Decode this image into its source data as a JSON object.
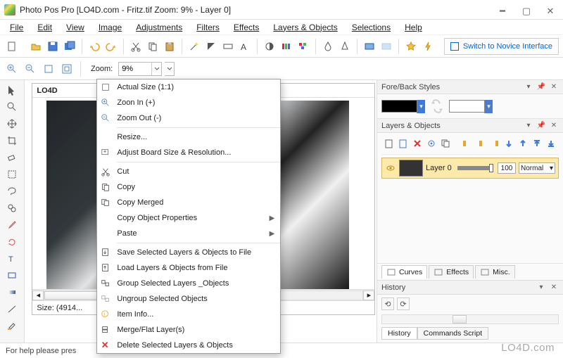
{
  "title": "Photo Pos Pro  [LO4D.com - Fritz.tif Zoom: 9% - Layer 0]",
  "menu": [
    "File",
    "Edit",
    "View",
    "Image",
    "Adjustments",
    "Filters",
    "Effects",
    "Layers & Objects",
    "Selections",
    "Help"
  ],
  "novice_btn_label": "Switch to Novice Interface",
  "zoom": {
    "label": "Zoom:",
    "value": "9%"
  },
  "left_tool_names": [
    "pointer-tool",
    "zoom-tool",
    "move-tool",
    "crop-tool",
    "eraser-tool",
    "magic-select-tool",
    "lasso-tool",
    "clone-tool",
    "color-picker-tool",
    "rotate-tool",
    "text-tool",
    "shape-tool",
    "gradient-tool",
    "line-tool",
    "paint-tool"
  ],
  "doc": {
    "tab_title": "LO4D",
    "status": "Size: (4914..."
  },
  "context_menu": [
    {
      "icon": "actual-size-icon",
      "label": "Actual Size (1:1)"
    },
    {
      "icon": "zoom-in-icon",
      "label": "Zoon In (+)"
    },
    {
      "icon": "zoom-out-icon",
      "label": "Zoom Out (-)"
    },
    {
      "sep": true
    },
    {
      "icon": null,
      "label": "Resize..."
    },
    {
      "icon": "adjust-board-icon",
      "label": "Adjust Board  Size & Resolution..."
    },
    {
      "sep": true
    },
    {
      "icon": "cut-icon",
      "label": "Cut"
    },
    {
      "icon": "copy-icon",
      "label": "Copy"
    },
    {
      "icon": "copy-merged-icon",
      "label": "Copy Merged"
    },
    {
      "icon": null,
      "label": "Copy Object Properties",
      "sub": true
    },
    {
      "icon": null,
      "label": "Paste",
      "sub": true
    },
    {
      "sep": true
    },
    {
      "icon": "save-layers-icon",
      "label": "Save Selected Layers & Objects to File"
    },
    {
      "icon": "load-layers-icon",
      "label": "Load Layers & Objects from File"
    },
    {
      "icon": "group-icon",
      "label": "Group Selected Layers _Objects"
    },
    {
      "icon": "ungroup-icon",
      "label": "Ungroup Selected Objects"
    },
    {
      "icon": "item-info-icon",
      "label": "Item Info..."
    },
    {
      "icon": "merge-icon",
      "label": "Merge/Flat Layer(s)"
    },
    {
      "icon": "delete-icon",
      "label": "Delete Selected Layers & Objects"
    }
  ],
  "panels": {
    "forestyles": {
      "title": "Fore/Back Styles"
    },
    "layers": {
      "title": "Layers & Objects",
      "layer_name": "Layer 0",
      "opacity": "100",
      "blend": "Normal",
      "tabs": [
        "Curves",
        "Effects",
        "Misc."
      ]
    },
    "history": {
      "title": "History",
      "tabs": [
        "History",
        "Commands Script"
      ]
    }
  },
  "statusbar_text": "For help please pres",
  "watermark": "LO4D.com"
}
